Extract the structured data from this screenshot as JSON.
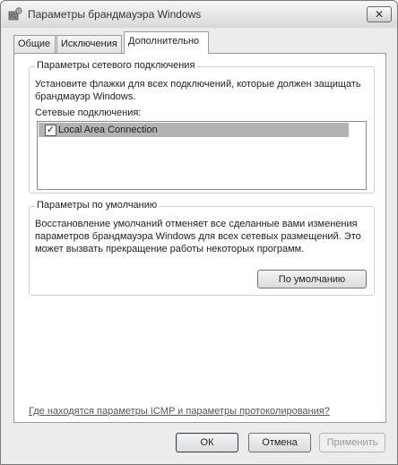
{
  "window": {
    "title": "Параметры брандмауэра Windows",
    "close_label": "✕"
  },
  "tabs": [
    {
      "label": "Общие",
      "active": false
    },
    {
      "label": "Исключения",
      "active": false
    },
    {
      "label": "Дополнительно",
      "active": true
    }
  ],
  "network": {
    "group_title": "Параметры сетевого подключения",
    "description": "Установите флажки для всех подключений, которые должен защищать брандмауэр Windows.",
    "list_label": "Сетевые подключения:",
    "connections": [
      {
        "label": "Local Area Connection",
        "checked": true,
        "check_glyph": "✓"
      }
    ]
  },
  "defaults": {
    "group_title": "Параметры по умолчанию",
    "description": "Восстановление умолчаний отменяет все сделанные вами изменения параметров брандмауэра Windows для всех сетевых размещений. Это может вызвать прекращение работы некоторых программ.",
    "restore_button": "По умолчанию"
  },
  "help_link": "Где находятся параметры ICMP и параметры протоколирования?",
  "buttons": {
    "ok": "ОК",
    "cancel": "Отмена",
    "apply": "Применить"
  }
}
